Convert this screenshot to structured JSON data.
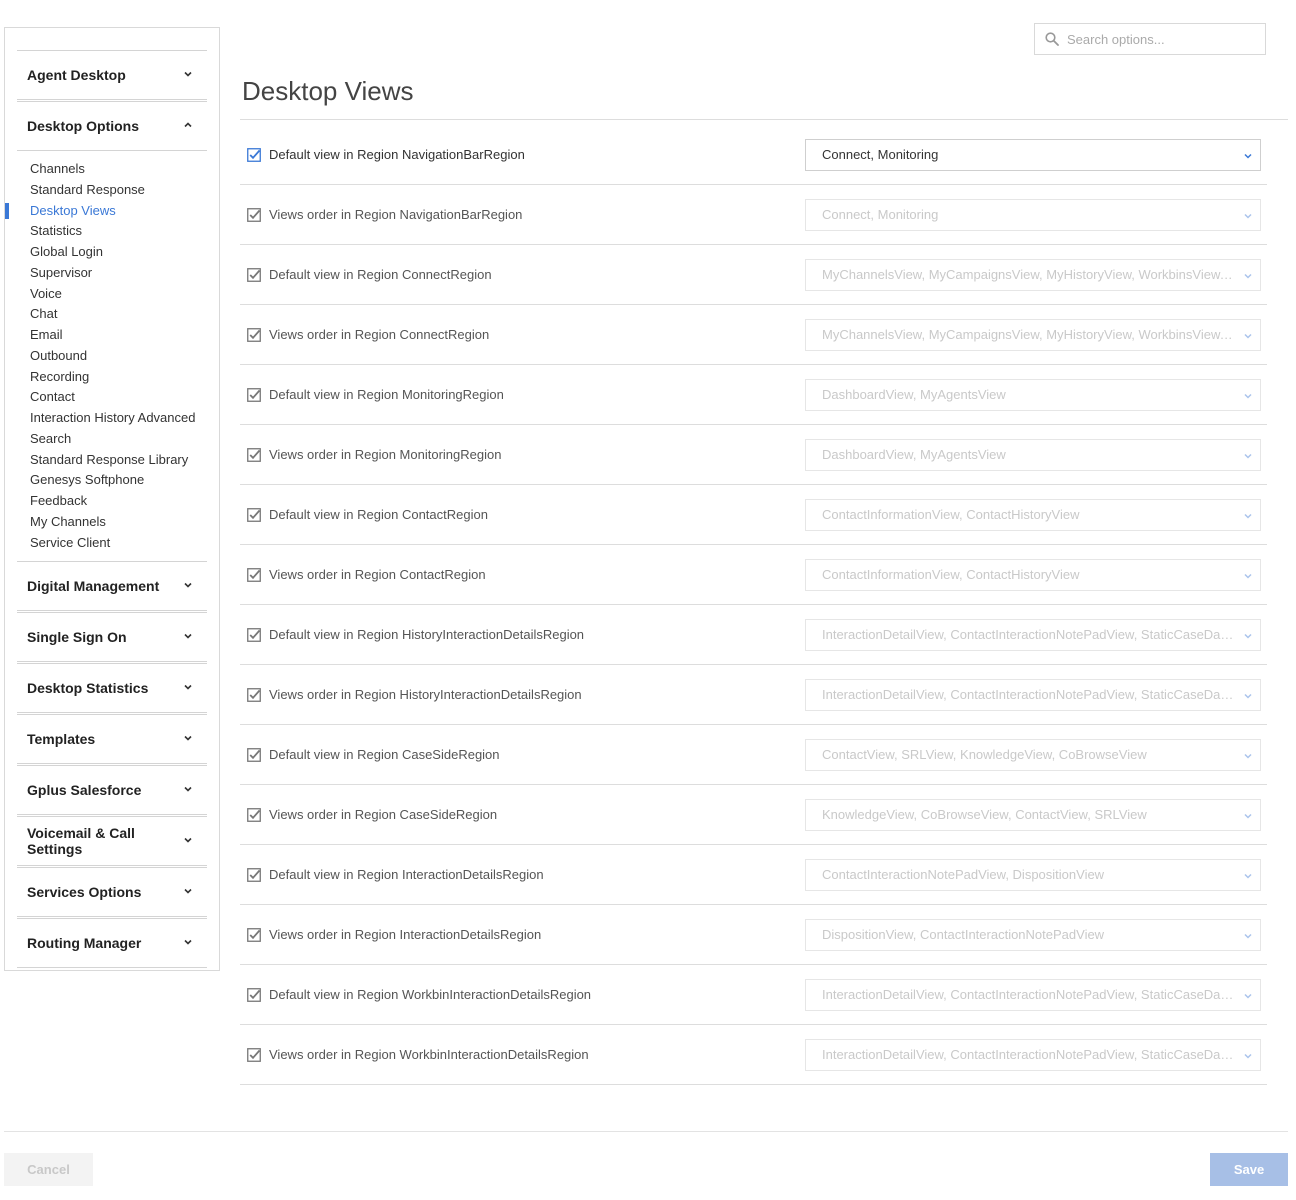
{
  "search": {
    "placeholder": "Search options..."
  },
  "page": {
    "title": "Desktop Views"
  },
  "sidebar": {
    "sections": [
      {
        "label": "Agent Desktop",
        "expanded": false
      },
      {
        "label": "Desktop Options",
        "expanded": true,
        "items": [
          "Channels",
          "Standard Response",
          "Desktop Views",
          "Statistics",
          "Global Login",
          "Supervisor",
          "Voice",
          "Chat",
          "Email",
          "Outbound",
          "Recording",
          "Contact",
          "Interaction History Advanced",
          "Search",
          "Standard Response Library",
          "Genesys Softphone",
          "Feedback",
          "My Channels",
          "Service Client"
        ],
        "active_item": "Desktop Views"
      },
      {
        "label": "Digital Management",
        "expanded": false
      },
      {
        "label": "Single Sign On",
        "expanded": false
      },
      {
        "label": "Desktop Statistics",
        "expanded": false
      },
      {
        "label": "Templates",
        "expanded": false
      },
      {
        "label": "Gplus Salesforce",
        "expanded": false
      },
      {
        "label": "Voicemail & Call Settings",
        "expanded": false
      },
      {
        "label": "Services Options",
        "expanded": false
      },
      {
        "label": "Routing Manager",
        "expanded": false
      }
    ]
  },
  "rows": [
    {
      "label": "Default view in Region NavigationBarRegion",
      "value": "Connect, Monitoring",
      "checked": true,
      "enabled": true
    },
    {
      "label": "Views order in Region NavigationBarRegion",
      "value": "Connect, Monitoring",
      "checked": true,
      "enabled": false
    },
    {
      "label": "Default view in Region ConnectRegion",
      "value": "MyChannelsView, MyCampaignsView, MyHistoryView, WorkbinsView, InteractionSearchView",
      "checked": true,
      "enabled": false
    },
    {
      "label": "Views order in Region ConnectRegion",
      "value": "MyChannelsView, MyCampaignsView, MyHistoryView, WorkbinsView, InteractionSearchView",
      "checked": true,
      "enabled": false
    },
    {
      "label": "Default view in Region MonitoringRegion",
      "value": "DashboardView, MyAgentsView",
      "checked": true,
      "enabled": false
    },
    {
      "label": "Views order in Region MonitoringRegion",
      "value": "DashboardView, MyAgentsView",
      "checked": true,
      "enabled": false
    },
    {
      "label": "Default view in Region ContactRegion",
      "value": "ContactInformationView, ContactHistoryView",
      "checked": true,
      "enabled": false
    },
    {
      "label": "Views order in Region ContactRegion",
      "value": "ContactInformationView, ContactHistoryView",
      "checked": true,
      "enabled": false
    },
    {
      "label": "Default view in Region HistoryInteractionDetailsRegion",
      "value": "InteractionDetailView, ContactInteractionNotePadView, StaticCaseDataView",
      "checked": true,
      "enabled": false
    },
    {
      "label": "Views order in Region HistoryInteractionDetailsRegion",
      "value": "InteractionDetailView, ContactInteractionNotePadView, StaticCaseDataView",
      "checked": true,
      "enabled": false
    },
    {
      "label": "Default view in Region CaseSideRegion",
      "value": "ContactView, SRLView, KnowledgeView, CoBrowseView",
      "checked": true,
      "enabled": false
    },
    {
      "label": "Views order in Region CaseSideRegion",
      "value": "KnowledgeView, CoBrowseView, ContactView, SRLView",
      "checked": true,
      "enabled": false
    },
    {
      "label": "Default view in Region InteractionDetailsRegion",
      "value": "ContactInteractionNotePadView, DispositionView",
      "checked": true,
      "enabled": false
    },
    {
      "label": "Views order in Region InteractionDetailsRegion",
      "value": "DispositionView, ContactInteractionNotePadView",
      "checked": true,
      "enabled": false
    },
    {
      "label": "Default view in Region WorkbinInteractionDetailsRegion",
      "value": "InteractionDetailView, ContactInteractionNotePadView, StaticCaseDataView",
      "checked": true,
      "enabled": false
    },
    {
      "label": "Views order in Region WorkbinInteractionDetailsRegion",
      "value": "InteractionDetailView, ContactInteractionNotePadView, StaticCaseDataView",
      "checked": true,
      "enabled": false
    }
  ],
  "footer": {
    "cancel_label": "Cancel",
    "save_label": "Save"
  },
  "colors": {
    "accent": "#3a78d6",
    "save_button": "#a7bfe6"
  },
  "icons": {
    "search": "search-icon",
    "section_toggle": "chevron-icon",
    "row_check": "checkbox-checked-icon",
    "select_toggle": "chevron-down-icon"
  }
}
